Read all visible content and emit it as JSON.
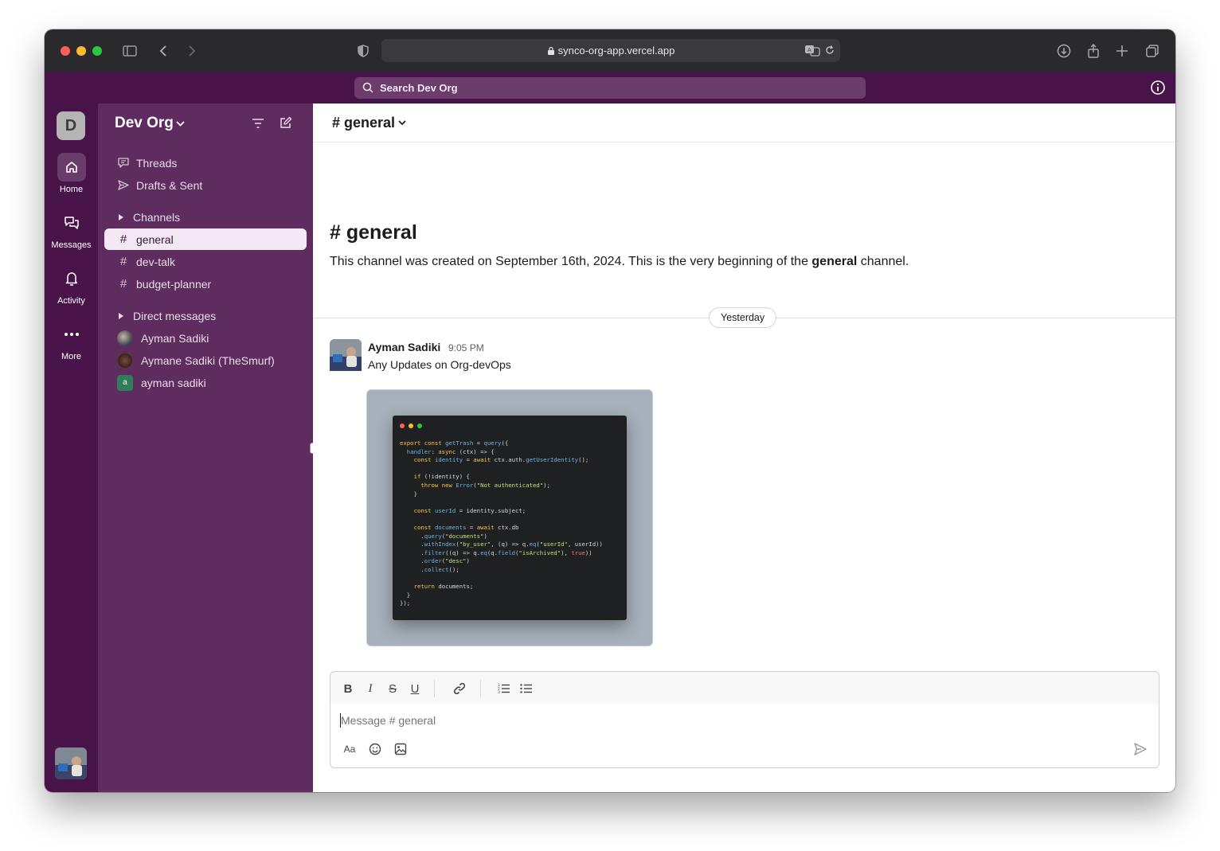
{
  "browser": {
    "url": "synco-org-app.vercel.app"
  },
  "search": {
    "placeholder": "Search Dev Org"
  },
  "workspace": {
    "initial": "D",
    "name": "Dev Org"
  },
  "rail": {
    "items": [
      {
        "label": "Home",
        "icon": "home-icon"
      },
      {
        "label": "Messages",
        "icon": "messages-icon"
      },
      {
        "label": "Activity",
        "icon": "bell-icon"
      },
      {
        "label": "More",
        "icon": "more-icon"
      }
    ]
  },
  "sidebar": {
    "threads": "Threads",
    "drafts": "Drafts & Sent",
    "channels_header": "Channels",
    "channels": [
      {
        "name": "general",
        "active": true
      },
      {
        "name": "dev-talk",
        "active": false
      },
      {
        "name": "budget-planner",
        "active": false
      }
    ],
    "dm_header": "Direct messages",
    "dms": [
      {
        "name": "Ayman Sadiki",
        "avatar": ""
      },
      {
        "name": "Aymane Sadiki (TheSmurf)",
        "avatar": ""
      },
      {
        "name": "ayman sadiki",
        "avatar": "a"
      }
    ]
  },
  "channel": {
    "header": "# general",
    "intro_title": "# general",
    "intro_prefix": "This channel was created on September 16th, 2024. This is the very beginning of the ",
    "intro_bold": "general",
    "intro_suffix": " channel.",
    "day_divider": "Yesterday"
  },
  "messages": [
    {
      "author": "Ayman Sadiki",
      "time": "9:05 PM",
      "text": "Any Updates on Org-devOps"
    }
  ],
  "composer": {
    "placeholder": "Message # general",
    "font_button": "Aa"
  },
  "colors": {
    "brand_dark": "#481349",
    "sidebar": "#5e2c5f",
    "active_item": "#f3e8f3"
  }
}
